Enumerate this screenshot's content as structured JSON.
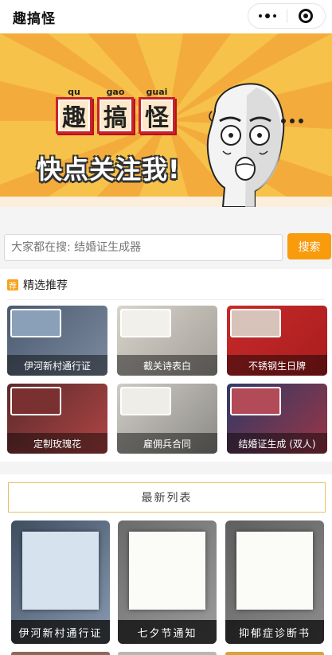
{
  "app": {
    "title": "趣搞怪"
  },
  "capsule": {
    "more_icon": "more-dots-icon",
    "close_icon": "record-circle-icon"
  },
  "banner": {
    "chars": [
      {
        "pinyin": "qu",
        "char": "趣"
      },
      {
        "pinyin": "gao",
        "char": "搞"
      },
      {
        "pinyin": "guai",
        "char": "怪"
      }
    ],
    "slogan": "快点关注我!",
    "colors": {
      "background": "#f6c24a",
      "tile_border": "#c7242b"
    }
  },
  "search": {
    "placeholder": "大家都在搜: 结婚证生成器",
    "button_label": "搜索",
    "button_color": "#f89b0c"
  },
  "featured": {
    "icon": "star-badge-icon",
    "title": "精选推荐",
    "items": [
      {
        "label": "伊河新村通行证"
      },
      {
        "label": "截关诗表白"
      },
      {
        "label": "不锈钢生日牌"
      },
      {
        "label": "定制玫瑰花"
      },
      {
        "label": "雇佣兵合同"
      },
      {
        "label": "结婚证生成 (双人)"
      }
    ]
  },
  "latest": {
    "title": "最新列表",
    "items": [
      {
        "label": "伊河新村通行证"
      },
      {
        "label": "七夕节通知"
      },
      {
        "label": "抑郁症诊断书"
      }
    ]
  }
}
